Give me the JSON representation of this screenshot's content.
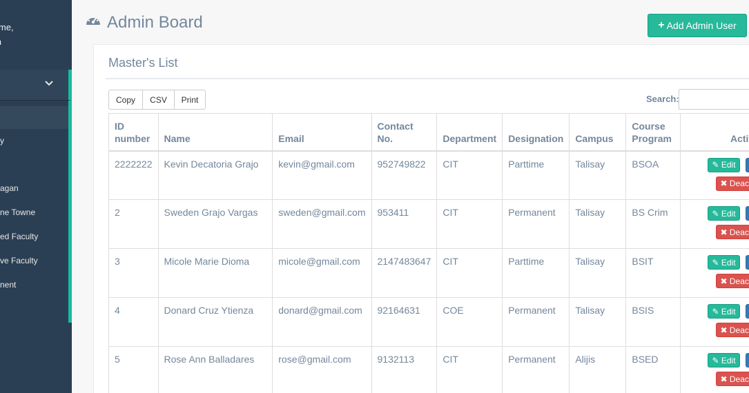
{
  "sidebar": {
    "welcome": "me,",
    "user_name": "n",
    "items": [
      {
        "label": "y"
      },
      {
        "label": "agan"
      },
      {
        "label": "ne Towne"
      },
      {
        "label": "ed Faculty"
      },
      {
        "label": "ve Faculty"
      },
      {
        "label": "nent"
      }
    ]
  },
  "header": {
    "title": "Admin Board",
    "add_button": "Add Admin User"
  },
  "panel": {
    "title": "Master's List",
    "buttons": {
      "copy": "Copy",
      "csv": "CSV",
      "print": "Print"
    },
    "search_label": "Search:",
    "search_value": ""
  },
  "table": {
    "headers": {
      "id": "ID number",
      "name": "Name",
      "email": "Email",
      "contact": "Contact No.",
      "department": "Department",
      "designation": "Designation",
      "campus": "Campus",
      "course": "Course Program",
      "action": "Actio"
    },
    "edit_label": "Edit",
    "deactivate_label": "Deactiv",
    "rows": [
      {
        "id": "2222222",
        "name": "Kevin Decatoria Grajo",
        "email": "kevin@gmail.com",
        "contact": "952749822",
        "department": "CIT",
        "designation": "Parttime",
        "campus": "Talisay",
        "course": "BSOA"
      },
      {
        "id": "2",
        "name": "Sweden Grajo Vargas",
        "email": "sweden@gmail.com",
        "contact": "953411",
        "department": "CIT",
        "designation": "Permanent",
        "campus": "Talisay",
        "course": "BS Crim"
      },
      {
        "id": "3",
        "name": "Micole Marie Dioma",
        "email": "micole@gmail.com",
        "contact": "2147483647",
        "department": "CIT",
        "designation": "Parttime",
        "campus": "Talisay",
        "course": "BSIT"
      },
      {
        "id": "4",
        "name": "Donard Cruz Ytienza",
        "email": "donard@gmail.com",
        "contact": "92164631",
        "department": "COE",
        "designation": "Permanent",
        "campus": "Talisay",
        "course": "BSIS"
      },
      {
        "id": "5",
        "name": "Rose Ann Balladares",
        "email": "rose@gmail.com",
        "contact": "9132113",
        "department": "CIT",
        "designation": "Permanent",
        "campus": "Alijis",
        "course": "BSED"
      }
    ]
  },
  "colors": {
    "sidebar_bg": "#2a3f54",
    "accent": "#1abb9c",
    "edit_btn": "#26b99a",
    "view_btn": "#337ab7",
    "deactivate_btn": "#d9534f"
  }
}
